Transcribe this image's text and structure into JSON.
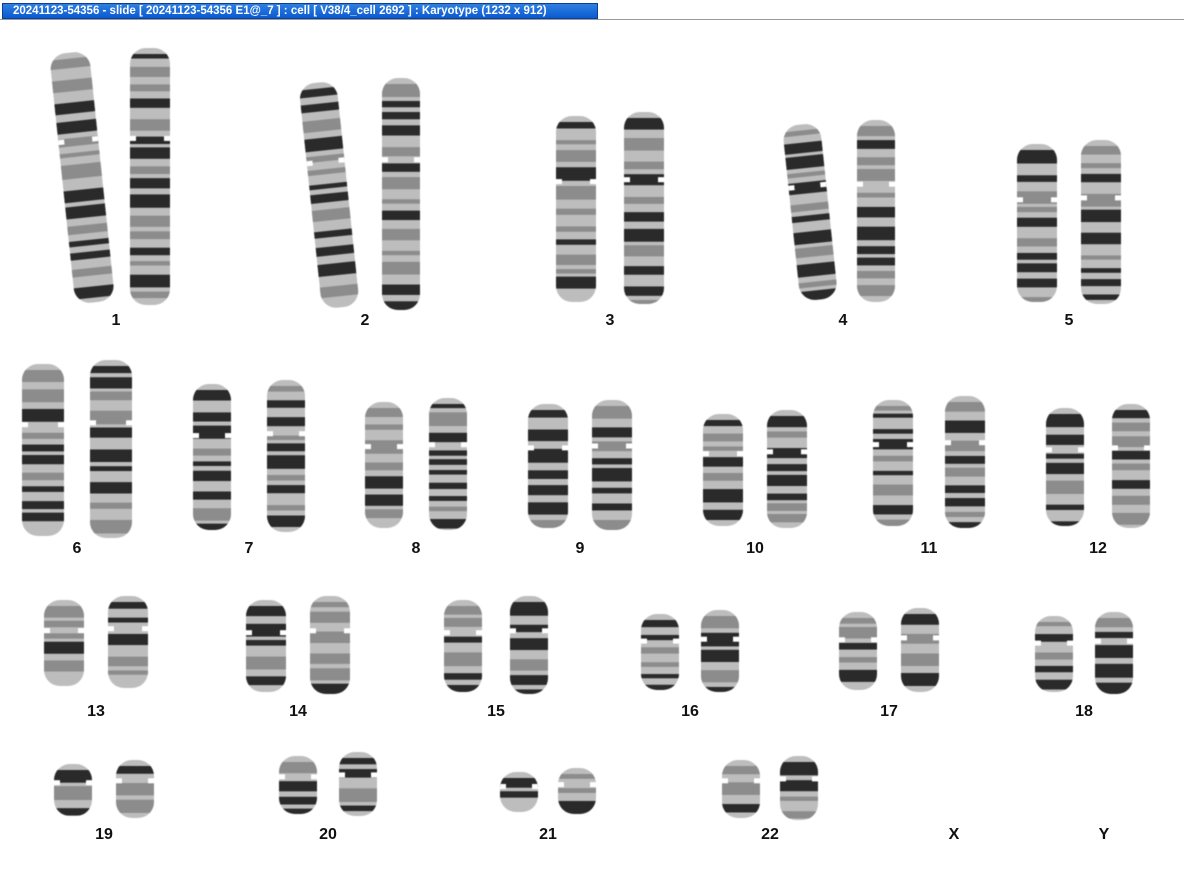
{
  "window": {
    "title": "20241123-54356 - slide [ 20241123-54356 E1@_7 ] : cell [ V38/4_cell 2692 ] : Karyotype  (1232 x 912)"
  },
  "karyotype": {
    "labels": [
      "1",
      "2",
      "3",
      "4",
      "5",
      "6",
      "7",
      "8",
      "9",
      "10",
      "11",
      "12",
      "13",
      "14",
      "15",
      "16",
      "17",
      "18",
      "19",
      "20",
      "21",
      "22",
      "X",
      "Y"
    ]
  },
  "colors": {
    "title_bar": "#0a5ad2",
    "title_text": "#ffffff",
    "chromosome_dark": "#2a2a2a",
    "chromosome_light": "#bdbdbd",
    "background": "#ffffff",
    "label_text": "#111111"
  }
}
